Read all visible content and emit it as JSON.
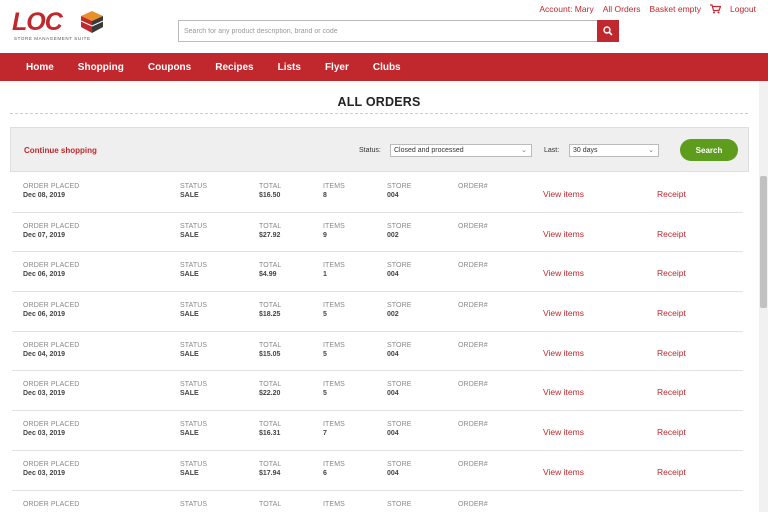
{
  "logo": {
    "text": "LOC",
    "subtitle": "Store Management Suite"
  },
  "search": {
    "placeholder": "Search for any product description, brand or code"
  },
  "top_links": {
    "account": "Account: Mary",
    "all_orders": "All Orders",
    "basket": "Basket empty",
    "logout": "Logout"
  },
  "nav": [
    "Home",
    "Shopping",
    "Coupons",
    "Recipes",
    "Lists",
    "Flyer",
    "Clubs"
  ],
  "page_title": "ALL ORDERS",
  "filters": {
    "continue_label": "Continue shopping",
    "status_label": "Status:",
    "status_value": "Closed and processed",
    "last_label": "Last:",
    "last_value": "30 days",
    "search_button": "Search"
  },
  "labels": {
    "order_placed": "ORDER PLACED",
    "status": "STATUS",
    "total": "TOTAL",
    "items": "ITEMS",
    "store": "STORE",
    "order_no": "ORDER#",
    "view_items": "View items",
    "receipt": "Receipt"
  },
  "orders": [
    {
      "date": "Dec 08, 2019",
      "status": "SALE",
      "total": "$16.50",
      "items": "8",
      "store": "004"
    },
    {
      "date": "Dec 07, 2019",
      "status": "SALE",
      "total": "$27.92",
      "items": "9",
      "store": "002"
    },
    {
      "date": "Dec 06, 2019",
      "status": "SALE",
      "total": "$4.99",
      "items": "1",
      "store": "004"
    },
    {
      "date": "Dec 06, 2019",
      "status": "SALE",
      "total": "$18.25",
      "items": "5",
      "store": "002"
    },
    {
      "date": "Dec 04, 2019",
      "status": "SALE",
      "total": "$15.05",
      "items": "5",
      "store": "004"
    },
    {
      "date": "Dec 03, 2019",
      "status": "SALE",
      "total": "$22.20",
      "items": "5",
      "store": "004"
    },
    {
      "date": "Dec 03, 2019",
      "status": "SALE",
      "total": "$16.31",
      "items": "7",
      "store": "004"
    },
    {
      "date": "Dec 03, 2019",
      "status": "SALE",
      "total": "$17.94",
      "items": "6",
      "store": "004"
    },
    {
      "date": "",
      "status": "",
      "total": "",
      "items": "",
      "store": ""
    }
  ],
  "colors": {
    "brand": "#c0282d",
    "go_button": "#5e9c1e"
  }
}
